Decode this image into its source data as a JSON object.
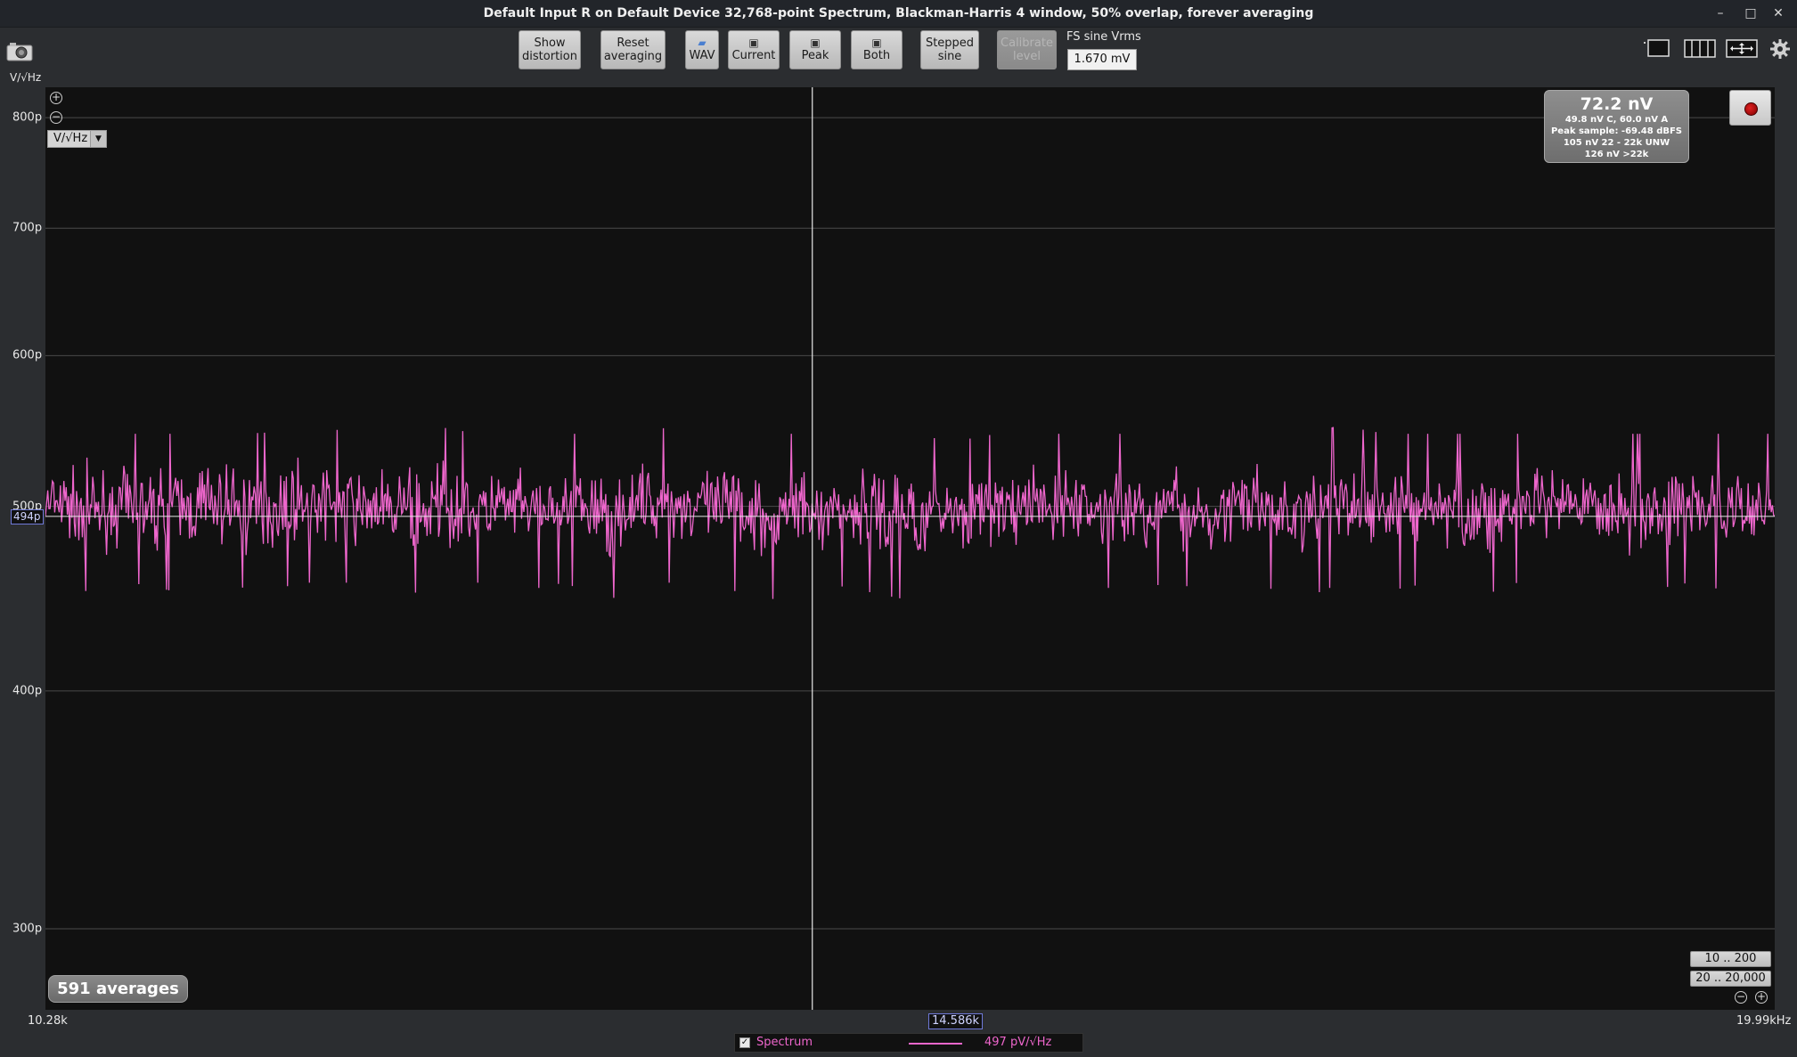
{
  "window": {
    "title": "Default Input R on Default Device 32,768-point Spectrum, Blackman-Harris 4 window, 50% overlap, forever averaging",
    "minimize": "–",
    "maximize": "□",
    "close": "✕"
  },
  "toolbar": {
    "show_distortion": [
      "Show",
      "distortion"
    ],
    "reset_averaging": [
      "Reset",
      "averaging"
    ],
    "wav": "WAV",
    "current": "Current",
    "peak": "Peak",
    "both": "Both",
    "stepped_sine": [
      "Stepped",
      "sine"
    ],
    "calibrate_level": [
      "Calibrate",
      "level"
    ],
    "fs_label": "FS sine Vrms",
    "fs_value": "1.670 mV",
    "icons": {
      "camera": "camera-icon",
      "folder": "folder-icon",
      "save": "floppy-disk-icon",
      "single_view": "single-window-icon",
      "multi_view": "multi-pane-icon",
      "fullscreen": "fullscreen-arrows-icon",
      "settings": "gear-icon"
    }
  },
  "unit_label": "V/√Hz",
  "units_select": {
    "value": "V/√Hz"
  },
  "readout": {
    "main": "72.2 nV",
    "line1": "49.8 nV C, 60.0 nV A",
    "line2": "Peak sample: -69.48 dBFS",
    "line3": "105 nV 22 - 22k UNW",
    "line4": "126 nV >22k"
  },
  "averages": "591 averages",
  "range_buttons": [
    "10 .. 200",
    "20 .. 20,000"
  ],
  "cursor": {
    "x_label": "14.586k",
    "y_label": "494p"
  },
  "legend": {
    "checked": "✓",
    "name": "Spectrum",
    "value": "497 pV/√Hz",
    "color": "#ee66cc"
  },
  "chart_data": {
    "type": "line",
    "title": "",
    "xlabel": "",
    "ylabel": "V/√Hz",
    "x_tick_labels": [
      "10.28k",
      "19.99kHz"
    ],
    "y_tick_labels": [
      "800p",
      "700p",
      "600p",
      "500p",
      "400p",
      "300p"
    ],
    "y_ticks": [
      8e-10,
      7e-10,
      6e-10,
      5e-10,
      4e-10,
      3e-10
    ],
    "xlim": [
      10280,
      19990
    ],
    "ylim": [
      2.72e-10,
      8.3e-10
    ],
    "y_scale": "log",
    "grid": true,
    "cursor_x": 14586,
    "cursor_y": 4.94e-10,
    "series": [
      {
        "name": "Spectrum",
        "color": "#ee66cc",
        "mean": 4.97e-10,
        "x": [
          10280,
          10523,
          10765,
          11008,
          11251,
          11493,
          11736,
          11979,
          12222,
          12464,
          12707,
          12950,
          13192,
          13435,
          13678,
          13920,
          14163,
          14406,
          14648,
          14891,
          15134,
          15377,
          15619,
          15862,
          16105,
          16347,
          16590,
          16833,
          17075,
          17318,
          17561,
          17803,
          18046,
          18289,
          18532,
          18774,
          19017,
          19260,
          19502,
          19745,
          19990
        ],
        "y_band_high": [
          5.3e-10,
          5.35e-10,
          5.3e-10,
          5.3e-10,
          5.35e-10,
          5.3e-10,
          5.4e-10,
          5.3e-10,
          5.3e-10,
          5.35e-10,
          5.3e-10,
          5.3e-10,
          5.3e-10,
          5.3e-10,
          5.35e-10,
          5.3e-10,
          5.35e-10,
          5.3e-10,
          5.3e-10,
          5.3e-10,
          5.3e-10,
          5.25e-10,
          5.3e-10,
          5.3e-10,
          5.3e-10,
          5.3e-10,
          5.3e-10,
          5.3e-10,
          5.3e-10,
          5.3e-10,
          5.35e-10,
          5.3e-10,
          5.3e-10,
          5.3e-10,
          5.3e-10,
          5.3e-10,
          5.3e-10,
          5.3e-10,
          5.3e-10,
          5.3e-10,
          5.3e-10
        ],
        "y_band_low": [
          4.7e-10,
          4.65e-10,
          4.7e-10,
          4.65e-10,
          4.7e-10,
          4.65e-10,
          4.7e-10,
          4.7e-10,
          4.7e-10,
          4.6e-10,
          4.7e-10,
          4.65e-10,
          4.7e-10,
          4.6e-10,
          4.7e-10,
          4.7e-10,
          4.65e-10,
          4.6e-10,
          4.7e-10,
          4.65e-10,
          4.6e-10,
          4.7e-10,
          4.65e-10,
          4.7e-10,
          4.7e-10,
          4.65e-10,
          4.7e-10,
          4.65e-10,
          4.7e-10,
          4.6e-10,
          4.7e-10,
          4.65e-10,
          4.7e-10,
          4.6e-10,
          4.7e-10,
          4.65e-10,
          4.7e-10,
          4.65e-10,
          4.7e-10,
          4.65e-10,
          4.7e-10
        ]
      }
    ]
  }
}
